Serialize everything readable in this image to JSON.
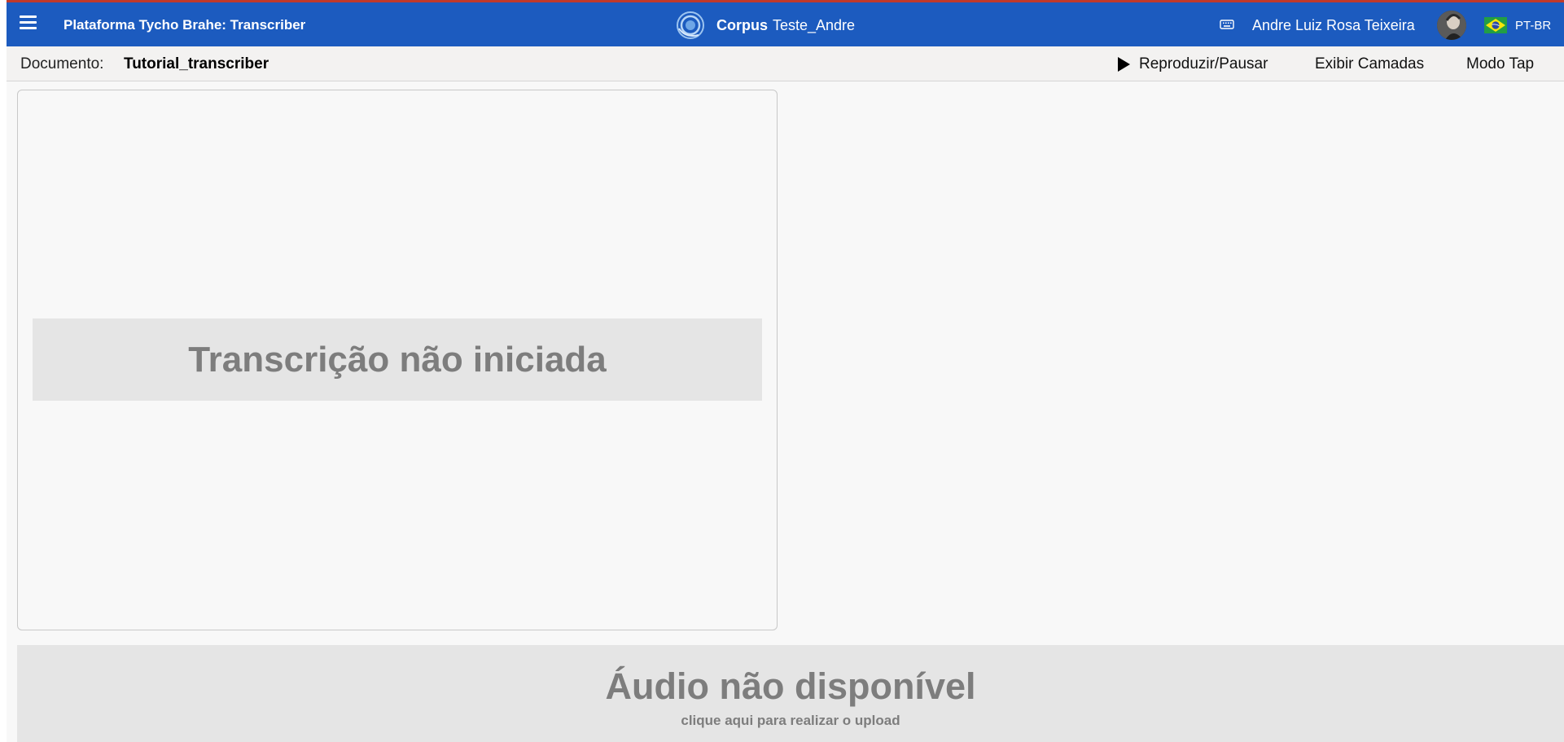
{
  "app": {
    "title": "Plataforma Tycho Brahe: Transcriber",
    "brand_color": "#1c5bbf",
    "accent_color": "#c0392b"
  },
  "header": {
    "menu_icon": "hamburger-icon",
    "corpus_logo_icon": "spiral-logo-icon",
    "corpus_label": "Corpus",
    "corpus_name": "Teste_Andre",
    "keyboard_icon": "keyboard-icon",
    "user_name": "Andre Luiz Rosa Teixeira",
    "language_flag_icon": "brazil-flag-icon",
    "language": "PT-BR"
  },
  "document_bar": {
    "label": "Documento:",
    "document_name": "Tutorial_transcriber",
    "play_pause_label": "Reproduzir/Pausar",
    "play_icon": "play-icon",
    "show_layers_label": "Exibir Camadas",
    "tap_mode_label": "Modo Tap"
  },
  "transcription": {
    "status": "Transcrição não iniciada"
  },
  "audio": {
    "status": "Áudio não disponível",
    "upload_hint": "clique aqui para realizar o upload"
  }
}
